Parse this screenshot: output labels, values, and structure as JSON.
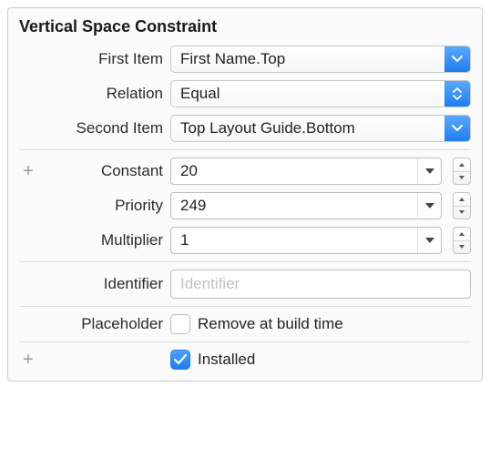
{
  "panel": {
    "title": "Vertical Space Constraint",
    "first_item": {
      "label": "First Item",
      "value": "First Name.Top"
    },
    "relation": {
      "label": "Relation",
      "value": "Equal"
    },
    "second_item": {
      "label": "Second Item",
      "value": "Top Layout Guide.Bottom"
    },
    "constant": {
      "label": "Constant",
      "value": "20"
    },
    "priority": {
      "label": "Priority",
      "value": "249"
    },
    "multiplier": {
      "label": "Multiplier",
      "value": "1"
    },
    "identifier": {
      "label": "Identifier",
      "placeholder": "Identifier",
      "value": ""
    },
    "placeholder_row": {
      "label": "Placeholder",
      "checkbox_label": "Remove at build time",
      "checked": false
    },
    "installed": {
      "label": "Installed",
      "checked": true
    },
    "plus_glyph": "+"
  }
}
